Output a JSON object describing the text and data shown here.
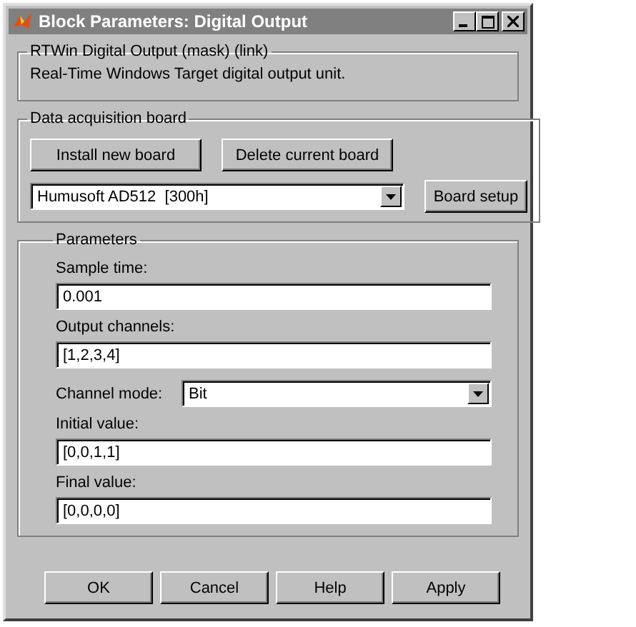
{
  "window": {
    "title": "Block Parameters: Digital Output"
  },
  "description": {
    "title": "RTWin Digital Output (mask) (link)",
    "text": "Real-Time Windows Target digital output unit."
  },
  "board": {
    "title": "Data acquisition board",
    "buttons": [
      "Install new board",
      "Delete current board"
    ],
    "selector": {
      "value": "Humusoft AD512  [300h]"
    },
    "setup_button": "Board setup"
  },
  "parameters": {
    "title": "Parameters",
    "items": [
      {
        "kind": "field",
        "label": "Sample time:",
        "value": "0.001"
      },
      {
        "kind": "field",
        "label": "Output channels:",
        "value": "[1,2,3,4]"
      },
      {
        "kind": "select",
        "label": "Channel mode:",
        "value": "Bit"
      },
      {
        "kind": "field",
        "label": "Initial value:",
        "value": "[0,0,1,1]"
      },
      {
        "kind": "field",
        "label": "Final value:",
        "value": "[0,0,0,0]"
      }
    ]
  },
  "buttons": [
    "OK",
    "Cancel",
    "Help",
    "Apply"
  ]
}
